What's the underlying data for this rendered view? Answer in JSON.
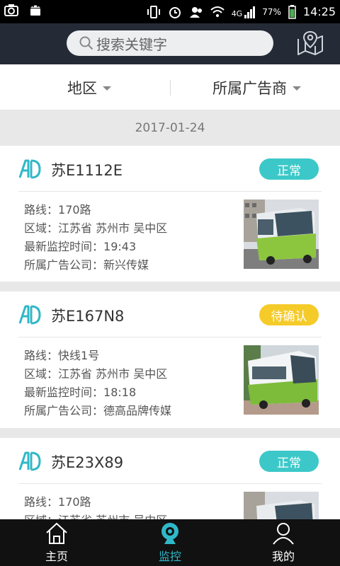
{
  "status_bar": {
    "battery": "77%",
    "time": "14:25",
    "network": "4G"
  },
  "search": {
    "placeholder": "搜索关键字"
  },
  "filters": {
    "region": "地区",
    "advertiser": "所属广告商"
  },
  "date_header": "2017-01-24",
  "labels": {
    "route": "路线：",
    "area": "区域：",
    "last_time": "最新监控时间：",
    "company": "所属广告公司："
  },
  "cards": [
    {
      "plate": "苏E1112E",
      "status": "正常",
      "route": "170路",
      "area": "江苏省 苏州市 吴中区",
      "last_time": "19:43",
      "company": "新兴传媒"
    },
    {
      "plate": "苏E167N8",
      "status": "待确认",
      "route": "快线1号",
      "area": "江苏省 苏州市 吴中区",
      "last_time": "18:18",
      "company": "德高品牌传媒"
    },
    {
      "plate": "苏E23X89",
      "status": "正常",
      "route": "170路",
      "area": "江苏省 苏州市 吴中区"
    }
  ],
  "nav": {
    "home": "主页",
    "monitor": "监控",
    "mine": "我的"
  },
  "colors": {
    "header_bg": "#242a36",
    "status_ok": "#3cc8c8",
    "status_pending": "#f5cb2a",
    "nav_active": "#2fb8c8"
  },
  "icons": [
    "camera-icon",
    "android-icon",
    "vibrate-icon",
    "alarm-icon",
    "contacts-icon",
    "wifi-icon",
    "signal-icon",
    "battery-icon",
    "search-icon",
    "map-pin-icon",
    "home-icon",
    "monitor-icon",
    "user-icon",
    "logo-icon"
  ]
}
